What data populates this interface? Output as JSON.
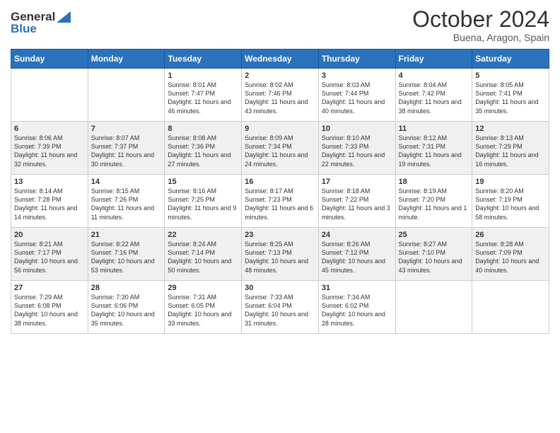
{
  "header": {
    "logo_general": "General",
    "logo_blue": "Blue",
    "month": "October 2024",
    "location": "Buena, Aragon, Spain"
  },
  "weekdays": [
    "Sunday",
    "Monday",
    "Tuesday",
    "Wednesday",
    "Thursday",
    "Friday",
    "Saturday"
  ],
  "weeks": [
    [
      {
        "day": "",
        "content": ""
      },
      {
        "day": "",
        "content": ""
      },
      {
        "day": "1",
        "content": "Sunrise: 8:01 AM\nSunset: 7:47 PM\nDaylight: 11 hours and 46 minutes."
      },
      {
        "day": "2",
        "content": "Sunrise: 8:02 AM\nSunset: 7:46 PM\nDaylight: 11 hours and 43 minutes."
      },
      {
        "day": "3",
        "content": "Sunrise: 8:03 AM\nSunset: 7:44 PM\nDaylight: 11 hours and 40 minutes."
      },
      {
        "day": "4",
        "content": "Sunrise: 8:04 AM\nSunset: 7:42 PM\nDaylight: 11 hours and 38 minutes."
      },
      {
        "day": "5",
        "content": "Sunrise: 8:05 AM\nSunset: 7:41 PM\nDaylight: 11 hours and 35 minutes."
      }
    ],
    [
      {
        "day": "6",
        "content": "Sunrise: 8:06 AM\nSunset: 7:39 PM\nDaylight: 11 hours and 32 minutes."
      },
      {
        "day": "7",
        "content": "Sunrise: 8:07 AM\nSunset: 7:37 PM\nDaylight: 11 hours and 30 minutes."
      },
      {
        "day": "8",
        "content": "Sunrise: 8:08 AM\nSunset: 7:36 PM\nDaylight: 11 hours and 27 minutes."
      },
      {
        "day": "9",
        "content": "Sunrise: 8:09 AM\nSunset: 7:34 PM\nDaylight: 11 hours and 24 minutes."
      },
      {
        "day": "10",
        "content": "Sunrise: 8:10 AM\nSunset: 7:33 PM\nDaylight: 11 hours and 22 minutes."
      },
      {
        "day": "11",
        "content": "Sunrise: 8:12 AM\nSunset: 7:31 PM\nDaylight: 11 hours and 19 minutes."
      },
      {
        "day": "12",
        "content": "Sunrise: 8:13 AM\nSunset: 7:29 PM\nDaylight: 11 hours and 16 minutes."
      }
    ],
    [
      {
        "day": "13",
        "content": "Sunrise: 8:14 AM\nSunset: 7:28 PM\nDaylight: 11 hours and 14 minutes."
      },
      {
        "day": "14",
        "content": "Sunrise: 8:15 AM\nSunset: 7:26 PM\nDaylight: 11 hours and 11 minutes."
      },
      {
        "day": "15",
        "content": "Sunrise: 8:16 AM\nSunset: 7:25 PM\nDaylight: 11 hours and 9 minutes."
      },
      {
        "day": "16",
        "content": "Sunrise: 8:17 AM\nSunset: 7:23 PM\nDaylight: 11 hours and 6 minutes."
      },
      {
        "day": "17",
        "content": "Sunrise: 8:18 AM\nSunset: 7:22 PM\nDaylight: 11 hours and 3 minutes."
      },
      {
        "day": "18",
        "content": "Sunrise: 8:19 AM\nSunset: 7:20 PM\nDaylight: 11 hours and 1 minute."
      },
      {
        "day": "19",
        "content": "Sunrise: 8:20 AM\nSunset: 7:19 PM\nDaylight: 10 hours and 58 minutes."
      }
    ],
    [
      {
        "day": "20",
        "content": "Sunrise: 8:21 AM\nSunset: 7:17 PM\nDaylight: 10 hours and 56 minutes."
      },
      {
        "day": "21",
        "content": "Sunrise: 8:22 AM\nSunset: 7:16 PM\nDaylight: 10 hours and 53 minutes."
      },
      {
        "day": "22",
        "content": "Sunrise: 8:24 AM\nSunset: 7:14 PM\nDaylight: 10 hours and 50 minutes."
      },
      {
        "day": "23",
        "content": "Sunrise: 8:25 AM\nSunset: 7:13 PM\nDaylight: 10 hours and 48 minutes."
      },
      {
        "day": "24",
        "content": "Sunrise: 8:26 AM\nSunset: 7:12 PM\nDaylight: 10 hours and 45 minutes."
      },
      {
        "day": "25",
        "content": "Sunrise: 8:27 AM\nSunset: 7:10 PM\nDaylight: 10 hours and 43 minutes."
      },
      {
        "day": "26",
        "content": "Sunrise: 8:28 AM\nSunset: 7:09 PM\nDaylight: 10 hours and 40 minutes."
      }
    ],
    [
      {
        "day": "27",
        "content": "Sunrise: 7:29 AM\nSunset: 6:08 PM\nDaylight: 10 hours and 38 minutes."
      },
      {
        "day": "28",
        "content": "Sunrise: 7:30 AM\nSunset: 6:06 PM\nDaylight: 10 hours and 35 minutes."
      },
      {
        "day": "29",
        "content": "Sunrise: 7:31 AM\nSunset: 6:05 PM\nDaylight: 10 hours and 33 minutes."
      },
      {
        "day": "30",
        "content": "Sunrise: 7:33 AM\nSunset: 6:04 PM\nDaylight: 10 hours and 31 minutes."
      },
      {
        "day": "31",
        "content": "Sunrise: 7:34 AM\nSunset: 6:02 PM\nDaylight: 10 hours and 28 minutes."
      },
      {
        "day": "",
        "content": ""
      },
      {
        "day": "",
        "content": ""
      }
    ]
  ]
}
